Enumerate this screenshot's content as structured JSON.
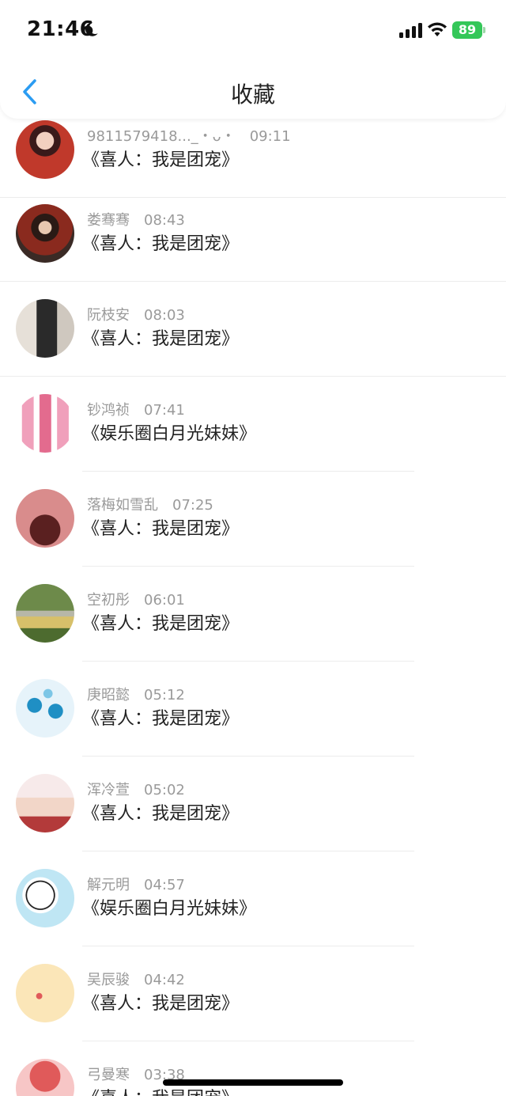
{
  "status": {
    "time": "21:46",
    "battery": "89"
  },
  "nav": {
    "title": "收藏"
  },
  "items": [
    {
      "name": "9811579418..._・ᴗ・",
      "time": "09:11",
      "book": "《喜人：我是团宠》",
      "avatar_colors": [
        "#c0392b",
        "#6b2a2a"
      ]
    },
    {
      "name": "娄骞骞",
      "time": "08:43",
      "book": "《喜人：我是团宠》",
      "avatar_colors": [
        "#7a2a1e",
        "#3a2a25"
      ]
    },
    {
      "name": "阮枝安",
      "time": "08:03",
      "book": "《喜人：我是团宠》",
      "avatar_colors": [
        "#d9d2c8",
        "#3b3b3b"
      ]
    },
    {
      "name": "钞鸿祯",
      "time": "07:41",
      "book": "《娱乐圈白月光妹妹》",
      "avatar_colors": [
        "#f3b5c8",
        "#e36b8e"
      ]
    },
    {
      "name": "落梅如雪乱",
      "time": "07:25",
      "book": "《喜人：我是团宠》",
      "avatar_colors": [
        "#d98c8c",
        "#7a3a3a"
      ]
    },
    {
      "name": "空初彤",
      "time": "06:01",
      "book": "《喜人：我是团宠》",
      "avatar_colors": [
        "#5b7a3a",
        "#c9b56a"
      ]
    },
    {
      "name": "庚昭懿",
      "time": "05:12",
      "book": "《喜人：我是团宠》",
      "avatar_colors": [
        "#e6f3fa",
        "#1f8fc4"
      ]
    },
    {
      "name": "浑冷萱",
      "time": "05:02",
      "book": "《喜人：我是团宠》",
      "avatar_colors": [
        "#f4dede",
        "#b33a3a"
      ]
    },
    {
      "name": "解元明",
      "time": "04:57",
      "book": "《娱乐圈白月光妹妹》",
      "avatar_colors": [
        "#bfe6f4",
        "#ffffff"
      ]
    },
    {
      "name": "吴辰骏",
      "time": "04:42",
      "book": "《喜人：我是团宠》",
      "avatar_colors": [
        "#fbe6b8",
        "#f3d59a"
      ]
    },
    {
      "name": "弓曼寒",
      "time": "03:38",
      "book": "《喜人：我是团宠》",
      "avatar_colors": [
        "#f7c6c6",
        "#e05a5a"
      ]
    }
  ]
}
